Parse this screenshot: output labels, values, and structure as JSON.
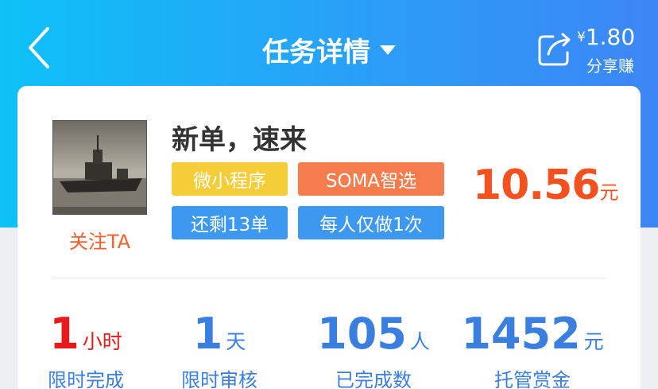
{
  "header": {
    "title": "任务详情",
    "share": {
      "currency": "¥",
      "amount": "1.80",
      "label": "分享赚"
    }
  },
  "task": {
    "follow_label": "关注TA",
    "title": "新单，速来",
    "tags": [
      "微小程序",
      "SOMA智选",
      "还剩13单",
      "每人仅做1次"
    ],
    "price": "10.56",
    "price_unit": "元"
  },
  "stats": [
    {
      "value": "1",
      "unit": "小时",
      "label": "限时完成"
    },
    {
      "value": "1",
      "unit": "天",
      "label": "限时审核"
    },
    {
      "value": "105",
      "unit": "人",
      "label": "已完成数"
    },
    {
      "value": "1452",
      "unit": "元",
      "label": "托管赏金"
    }
  ],
  "colors": {
    "header_start": "#0ec1f7",
    "header_end": "#3d86f5",
    "price": "#f4511e",
    "stat_red": "#e81919",
    "stat_blue": "#3a7ee0",
    "tag_yellow": "#f4cd39",
    "tag_orange": "#f47c4d",
    "tag_blue": "#3d98ef"
  }
}
